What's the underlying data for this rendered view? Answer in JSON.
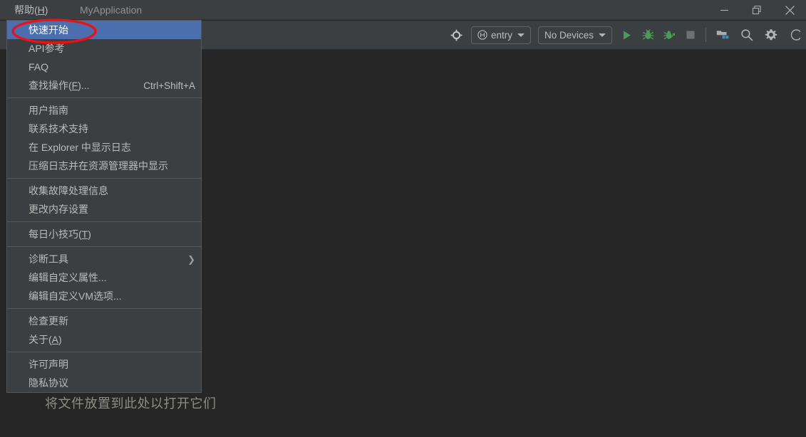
{
  "window": {
    "app_title": "MyApplication",
    "controls": [
      {
        "name": "minimize",
        "glyph": "minimize-icon"
      },
      {
        "name": "restore",
        "glyph": "restore-icon"
      },
      {
        "name": "close",
        "glyph": "close-icon"
      }
    ]
  },
  "menubar": {
    "items": [
      {
        "label_before": "帮助(",
        "mnemonic": "H",
        "label_after": ")",
        "name": "menubar-item-help"
      }
    ]
  },
  "toolbar": {
    "locate_icon": "target-icon",
    "run_config": {
      "icon": "harmony-module-icon",
      "label": "entry",
      "caret": "chevron-down-icon"
    },
    "device_select": {
      "label": "No Devices",
      "caret": "chevron-down-icon"
    },
    "actions": [
      {
        "name": "run-button",
        "icon": "play-icon",
        "color": "#499c54"
      },
      {
        "name": "debug-button",
        "icon": "bug-icon",
        "color": "#499c54"
      },
      {
        "name": "attach-debugger-button",
        "icon": "bug-attach-icon",
        "color": "#499c54"
      },
      {
        "name": "stop-button",
        "icon": "stop-square-icon",
        "color": "#6e7174"
      },
      {
        "name": "project-structure-button",
        "icon": "project-structure-icon",
        "color": "#a9adb0"
      },
      {
        "name": "search-everywhere-button",
        "icon": "search-icon",
        "color": "#a9adb0"
      },
      {
        "name": "settings-button",
        "icon": "gear-icon",
        "color": "#a9adb0"
      },
      {
        "name": "account-button",
        "icon": "account-circle-icon",
        "color": "#a9adb0"
      }
    ]
  },
  "help_menu": {
    "groups": [
      {
        "items": [
          {
            "label": "快速开始",
            "name": "menu-item-quick-start",
            "selected": true,
            "accel": "",
            "submenu": false
          },
          {
            "label": "API参考",
            "name": "menu-item-api-reference",
            "selected": false,
            "accel": "",
            "submenu": false
          },
          {
            "label": "FAQ",
            "name": "menu-item-faq",
            "selected": false,
            "accel": "",
            "submenu": false
          },
          {
            "label_before": "查找操作(",
            "mnemonic": "F",
            "label_after": ")...",
            "name": "menu-item-find-action",
            "selected": false,
            "accel": "Ctrl+Shift+A",
            "submenu": false
          }
        ]
      },
      {
        "items": [
          {
            "label": "用户指南",
            "name": "menu-item-user-guide",
            "selected": false,
            "accel": "",
            "submenu": false
          },
          {
            "label": "联系技术支持",
            "name": "menu-item-contact-support",
            "selected": false,
            "accel": "",
            "submenu": false
          },
          {
            "label": "在 Explorer 中显示日志",
            "name": "menu-item-show-log-in-explorer",
            "selected": false,
            "accel": "",
            "submenu": false
          },
          {
            "label": "压缩日志并在资源管理器中显示",
            "name": "menu-item-compress-logs-and-show",
            "selected": false,
            "accel": "",
            "submenu": false
          }
        ]
      },
      {
        "items": [
          {
            "label": "收集故障处理信息",
            "name": "menu-item-collect-troubleshooting-info",
            "selected": false,
            "accel": "",
            "submenu": false
          },
          {
            "label": "更改内存设置",
            "name": "menu-item-change-memory-settings",
            "selected": false,
            "accel": "",
            "submenu": false
          }
        ]
      },
      {
        "items": [
          {
            "label_before": "每日小技巧(",
            "mnemonic": "T",
            "label_after": ")",
            "name": "menu-item-tip-of-the-day",
            "selected": false,
            "accel": "",
            "submenu": false
          }
        ]
      },
      {
        "items": [
          {
            "label": "诊断工具",
            "name": "menu-item-diagnostic-tools",
            "selected": false,
            "accel": "",
            "submenu": true
          },
          {
            "label": "编辑自定义属性...",
            "name": "menu-item-edit-custom-properties",
            "selected": false,
            "accel": "",
            "submenu": false
          },
          {
            "label": "编辑自定义VM选项...",
            "name": "menu-item-edit-custom-vm-options",
            "selected": false,
            "accel": "",
            "submenu": false
          }
        ]
      },
      {
        "items": [
          {
            "label": "检查更新",
            "name": "menu-item-check-for-updates",
            "selected": false,
            "accel": "",
            "submenu": false
          },
          {
            "label_before": "关于(",
            "mnemonic": "A",
            "label_after": ")",
            "name": "menu-item-about",
            "selected": false,
            "accel": "",
            "submenu": false
          }
        ]
      },
      {
        "items": [
          {
            "label": "许可声明",
            "name": "menu-item-license-statement",
            "selected": false,
            "accel": "",
            "submenu": false
          },
          {
            "label": "隐私协议",
            "name": "menu-item-privacy-policy",
            "selected": false,
            "accel": "",
            "submenu": false
          }
        ]
      }
    ]
  },
  "editor": {
    "drop_hint": "将文件放置到此处以打开它们"
  },
  "annotation": {
    "shape": "ellipse-highlight",
    "color": "#ee1111",
    "targets": "menu-item-quick-start"
  },
  "colors": {
    "titlebar_bg": "#3c3f41",
    "toolbar_bg": "#3c3f41",
    "editor_bg": "#262626",
    "menu_bg": "#3c3f41",
    "menu_border": "#53575a",
    "menu_selected": "#4b6eaf",
    "text": "#bbbbbb",
    "accent_green": "#499c54",
    "annotation_red": "#ee1111"
  }
}
